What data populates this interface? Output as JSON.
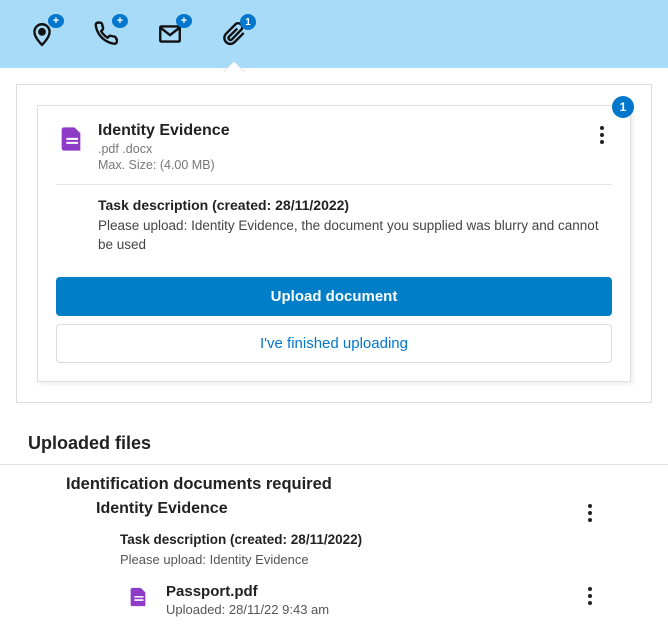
{
  "topbar": {
    "items": [
      {
        "name": "location-icon",
        "badge": "+"
      },
      {
        "name": "phone-icon",
        "badge": "+"
      },
      {
        "name": "mail-icon",
        "badge": "+"
      },
      {
        "name": "attachment-icon",
        "badge": "1"
      }
    ]
  },
  "task": {
    "badge": "1",
    "title": "Identity Evidence",
    "file_types": ".pdf .docx",
    "max_size": "Max. Size: (4.00 MB)",
    "desc_heading": "Task description (created: 28/11/2022)",
    "desc_text": "Please upload: Identity Evidence, the document you supplied was blurry and cannot be used",
    "upload_btn": "Upload document",
    "finished_btn": "I've finished uploading"
  },
  "uploaded": {
    "heading": "Uploaded files",
    "group_title": "Identification documents required",
    "sub_title": "Identity Evidence",
    "desc_heading": "Task description (created: 28/11/2022)",
    "desc_text": "Please upload: Identity Evidence",
    "file": {
      "name": "Passport.pdf",
      "meta": "Uploaded: 28/11/22 9:43 am"
    }
  }
}
